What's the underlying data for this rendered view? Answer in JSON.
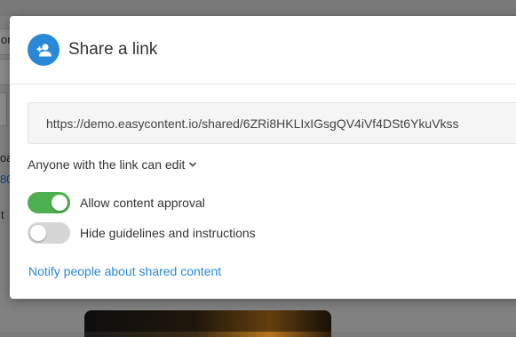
{
  "background": {
    "fragments": [
      "on",
      "oa",
      "80",
      "t"
    ]
  },
  "dialog": {
    "title": "Share a link",
    "icon": "add-person-icon",
    "link_url": "https://demo.easycontent.io/shared/6ZRi8HKLIxIGsgQV4iVf4DSt6YkuVkss",
    "permission_label": "Anyone with the link can edit",
    "toggles": [
      {
        "label": "Allow content approval",
        "checked": true
      },
      {
        "label": "Hide guidelines and instructions",
        "checked": false
      }
    ],
    "notify_label": "Notify people about shared content"
  },
  "colors": {
    "accent": "#2a88d8",
    "toggle_on": "#4caf50",
    "toggle_off": "#d6d6d6"
  }
}
